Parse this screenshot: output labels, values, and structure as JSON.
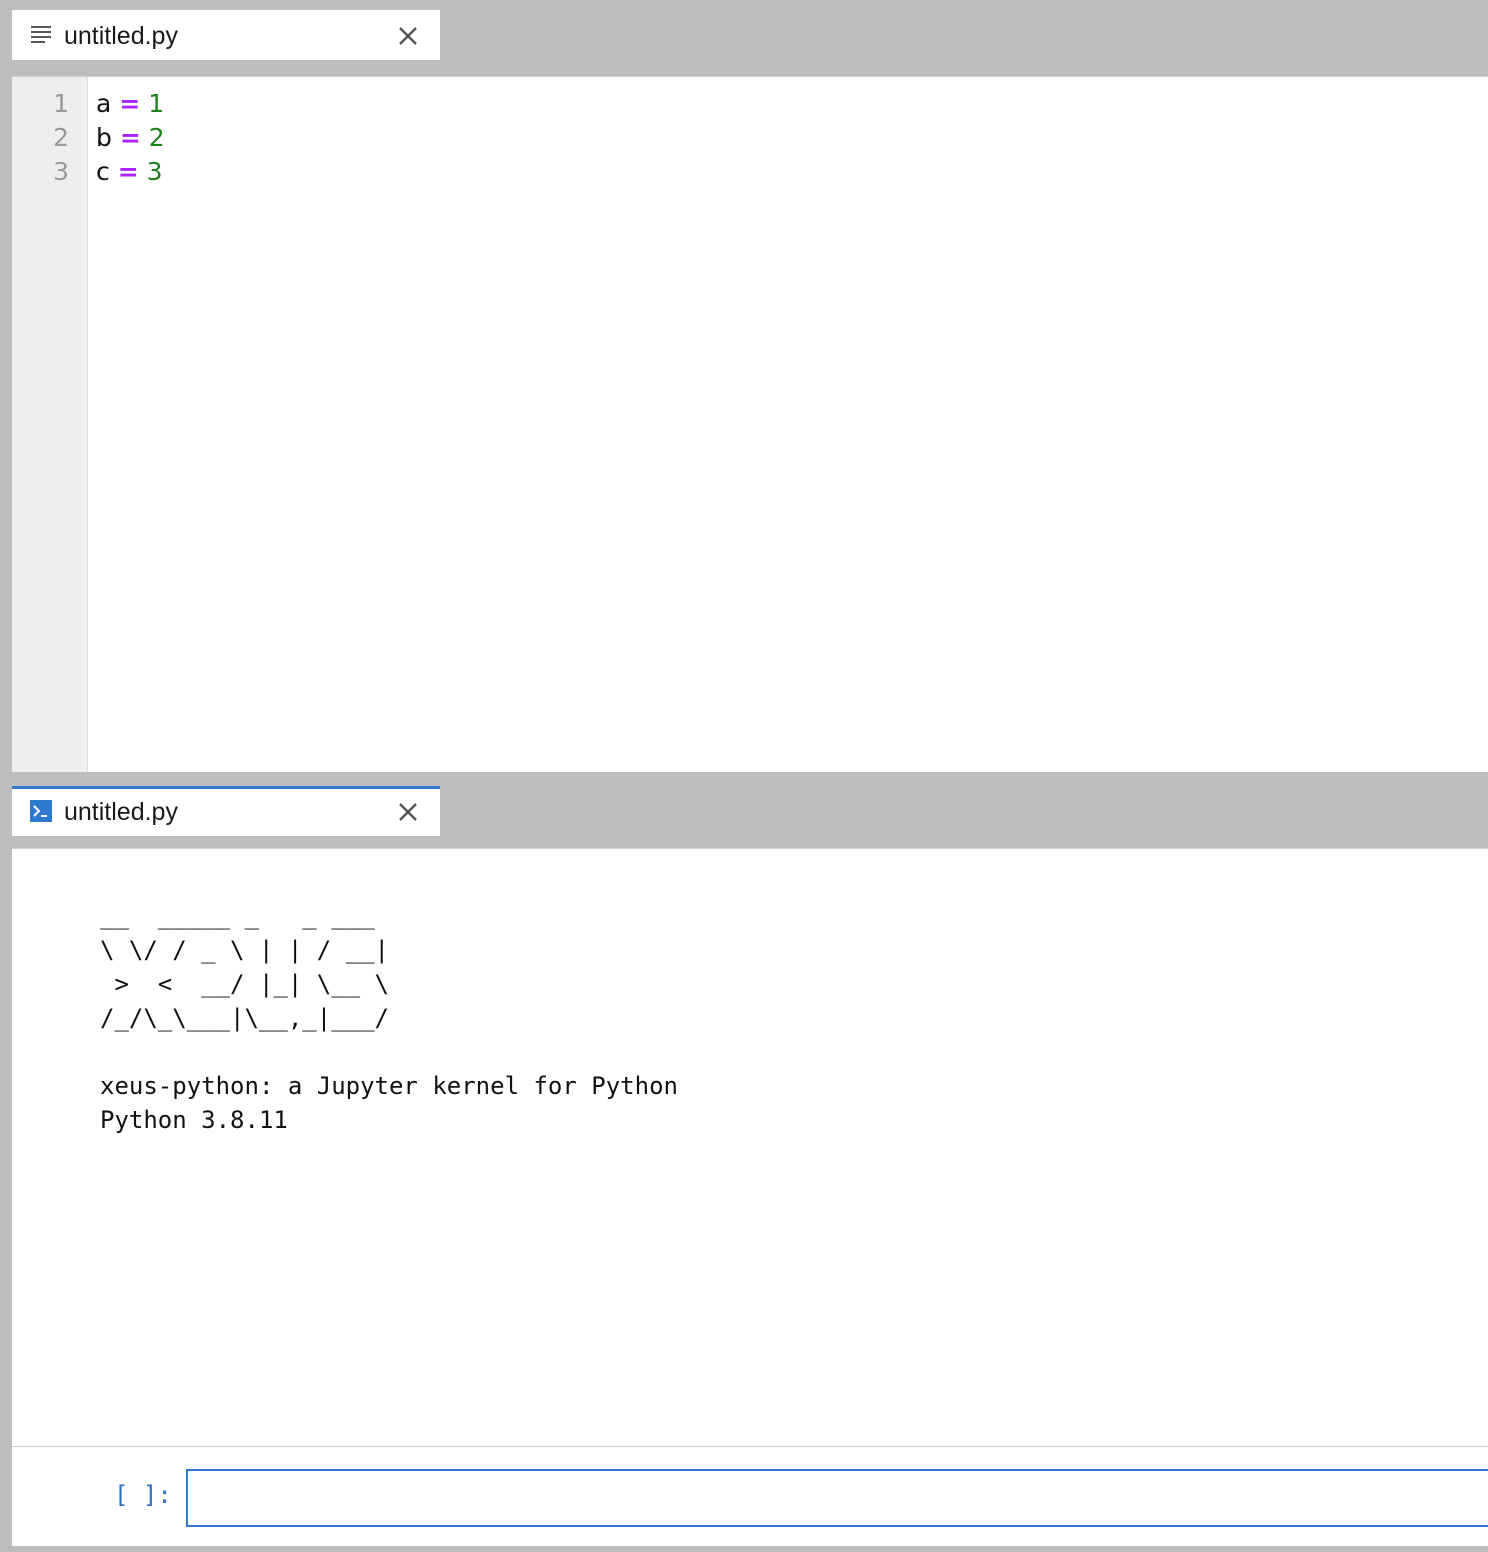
{
  "editor": {
    "tab_label": "untitled.py",
    "tab_icon": "text-file-icon",
    "lines": [
      {
        "num": "1",
        "var": "a",
        "op": "=",
        "val": "1"
      },
      {
        "num": "2",
        "var": "b",
        "op": "=",
        "val": "2"
      },
      {
        "num": "3",
        "var": "c",
        "op": "=",
        "val": "3"
      }
    ]
  },
  "console": {
    "tab_label": "untitled.py",
    "tab_icon": "console-icon",
    "banner_art": "__  _____ _   _ ___\n\\ \\/ / _ \\ | | / __|\n >  <  __/ |_| \\__ \\\n/_/\\_\\___|\\__,_|___/",
    "kernel_line": "xeus-python: a Jupyter kernel for Python",
    "version_line": "Python 3.8.11",
    "prompt": "[ ]:",
    "input_value": ""
  },
  "colors": {
    "accent": "#2f7ad1",
    "operator": "#aa22ff",
    "number": "#208020",
    "prompt": "#3070b8"
  }
}
